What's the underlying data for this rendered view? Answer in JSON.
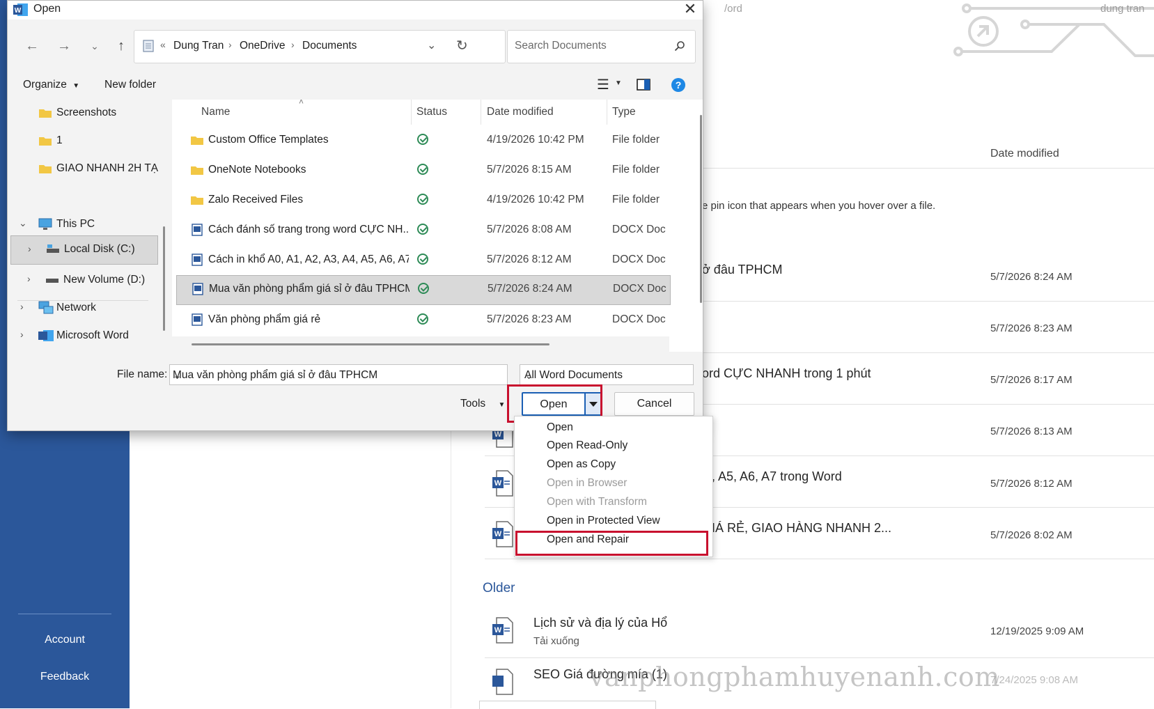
{
  "backstage": {
    "sidebar": {
      "account": "Account",
      "feedback": "Feedback"
    },
    "header_partial": "/ord",
    "username": "dung tran",
    "column_date": "Date modified",
    "pin_hint": "e pin icon that appears when you hover over a file.",
    "recent": [
      {
        "title": "ở đâu TPHCM",
        "date": "5/7/2026 8:24 AM"
      },
      {
        "title": "",
        "date": "5/7/2026 8:23 AM"
      },
      {
        "title": "ord CỰC NHANH trong 1 phút",
        "date": "5/7/2026 8:17 AM"
      },
      {
        "title": "",
        "date": "5/7/2026 8:13 AM"
      },
      {
        "title": ", A5, A6, A7 trong Word",
        "date": "5/7/2026 8:12 AM"
      },
      {
        "title": "IÁ RẺ, GIAO HÀNG NHANH 2...",
        "date": "5/7/2026 8:02 AM"
      }
    ],
    "older_label": "Older",
    "older": [
      {
        "title": "Lịch sử và địa lý của Hổ",
        "sub": "Tải xuống",
        "date": "12/19/2025 9:09 AM"
      },
      {
        "title": "SEO Giá đường mía (1)",
        "sub": "",
        "date": "7/24/2025 9:08 AM"
      }
    ],
    "watermark": "vanphongphamhuyenanh.com"
  },
  "dialog": {
    "title": "Open",
    "breadcrumb": {
      "overflow": "«",
      "parts": [
        "Dung Tran",
        "OneDrive",
        "Documents"
      ]
    },
    "search_placeholder": "Search Documents",
    "toolbar": {
      "organize": "Organize",
      "new_folder": "New folder"
    },
    "nav": [
      {
        "label": "Screenshots",
        "icon": "folder-icon"
      },
      {
        "label": "1",
        "icon": "folder-icon"
      },
      {
        "label": "GIAO NHANH 2H TẠ",
        "icon": "folder-icon"
      },
      {
        "label": "This PC",
        "icon": "pc-icon"
      },
      {
        "label": "Local Disk (C:)",
        "icon": "drive-icon"
      },
      {
        "label": "New Volume (D:)",
        "icon": "drive-icon"
      },
      {
        "label": "Network",
        "icon": "network-icon"
      },
      {
        "label": "Microsoft Word",
        "icon": "word-icon"
      }
    ],
    "columns": {
      "name": "Name",
      "status": "Status",
      "date": "Date modified",
      "type": "Type"
    },
    "files": [
      {
        "name": "Custom Office Templates",
        "date": "4/19/2026 10:42 PM",
        "type": "File folder",
        "icon": "folder-icon"
      },
      {
        "name": "OneNote Notebooks",
        "date": "5/7/2026 8:15 AM",
        "type": "File folder",
        "icon": "folder-icon"
      },
      {
        "name": "Zalo Received Files",
        "date": "4/19/2026 10:42 PM",
        "type": "File folder",
        "icon": "folder-icon"
      },
      {
        "name": "Cách đánh số trang trong word CỰC NH...",
        "date": "5/7/2026 8:08 AM",
        "type": "DOCX Doc",
        "icon": "docx-icon"
      },
      {
        "name": "Cách in khổ A0, A1, A2, A3, A4, A5, A6, A7...",
        "date": "5/7/2026 8:12 AM",
        "type": "DOCX Doc",
        "icon": "docx-icon"
      },
      {
        "name": "Mua văn phòng phẩm giá sỉ ở đâu TPHCM",
        "date": "5/7/2026 8:24 AM",
        "type": "DOCX Doc",
        "icon": "docx-icon"
      },
      {
        "name": "Văn phòng phẩm giá rẻ",
        "date": "5/7/2026 8:23 AM",
        "type": "DOCX Doc",
        "icon": "docx-icon"
      }
    ],
    "file_name_label": "File name:",
    "file_name_value": "Mua văn phòng phẩm giá sỉ ở đâu TPHCM",
    "file_type_filter": "All Word Documents",
    "tools_label": "Tools",
    "open_label": "Open",
    "cancel_label": "Cancel"
  },
  "open_menu": [
    {
      "label": "Open",
      "enabled": true
    },
    {
      "label": "Open Read-Only",
      "enabled": true
    },
    {
      "label": "Open as Copy",
      "enabled": true
    },
    {
      "label": "Open in Browser",
      "enabled": false
    },
    {
      "label": "Open with Transform",
      "enabled": false
    },
    {
      "label": "Open in Protected View",
      "enabled": true
    },
    {
      "label": "Open and Repair",
      "enabled": true
    }
  ],
  "colors": {
    "word_blue": "#2b579a",
    "highlight_red": "#c8102e",
    "status_green": "#2e8b57",
    "folder_yellow": "#f2c744"
  }
}
